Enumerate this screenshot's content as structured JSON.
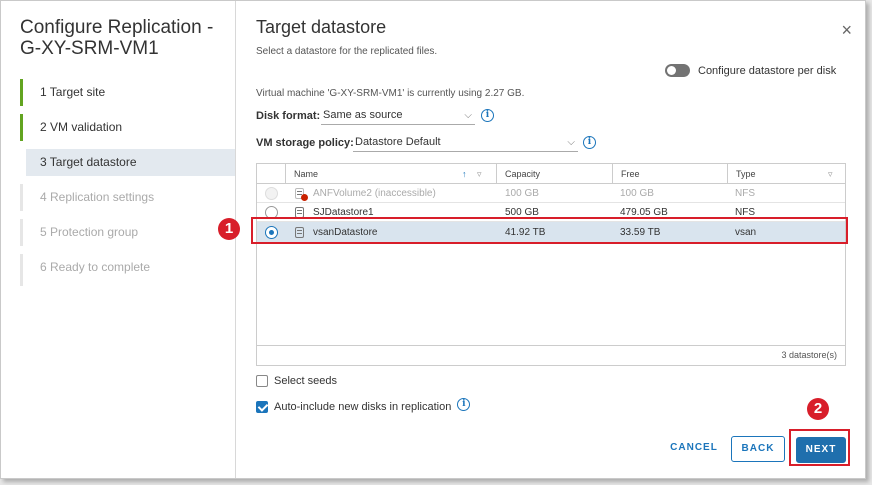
{
  "wizard": {
    "title": "Configure Replication - G-XY-SRM-VM1",
    "steps": [
      {
        "label": "1  Target site"
      },
      {
        "label": "2  VM validation"
      },
      {
        "label": "3  Target datastore"
      },
      {
        "label": "4  Replication settings"
      },
      {
        "label": "5  Protection group"
      },
      {
        "label": "6  Ready to complete"
      }
    ]
  },
  "page": {
    "title": "Target datastore",
    "subtitle": "Select a datastore for the replicated files.",
    "close_glyph": "×",
    "toggle_label": "Configure datastore per disk",
    "vm_usage": "Virtual machine 'G-XY-SRM-VM1' is currently using 2.27 GB.",
    "disk_format": {
      "label": "Disk format:",
      "value": "Same as source"
    },
    "storage_policy": {
      "label": "VM storage policy:",
      "value": "Datastore Default"
    }
  },
  "grid": {
    "columns": [
      "Name",
      "Capacity",
      "Free",
      "Type"
    ],
    "rows": [
      {
        "name": "ANFVolume2 (inaccessible)",
        "capacity": "100 GB",
        "free": "100 GB",
        "type": "NFS"
      },
      {
        "name": "SJDatastore1",
        "capacity": "500 GB",
        "free": "479.05 GB",
        "type": "NFS"
      },
      {
        "name": "vsanDatastore",
        "capacity": "41.92 TB",
        "free": "33.59 TB",
        "type": "vsan"
      }
    ],
    "footer": "3 datastore(s)"
  },
  "options": {
    "select_seeds": "Select seeds",
    "auto_include": "Auto-include new disks in replication"
  },
  "buttons": {
    "cancel": "CANCEL",
    "back": "BACK",
    "next": "NEXT"
  },
  "annotations": {
    "badge1": "1",
    "badge2": "2",
    "highlight_color": "#d81e2a"
  },
  "colors": {
    "accent": "#1b75bb",
    "step_done": "#62a420",
    "selected_row": "#d9e4ee"
  }
}
